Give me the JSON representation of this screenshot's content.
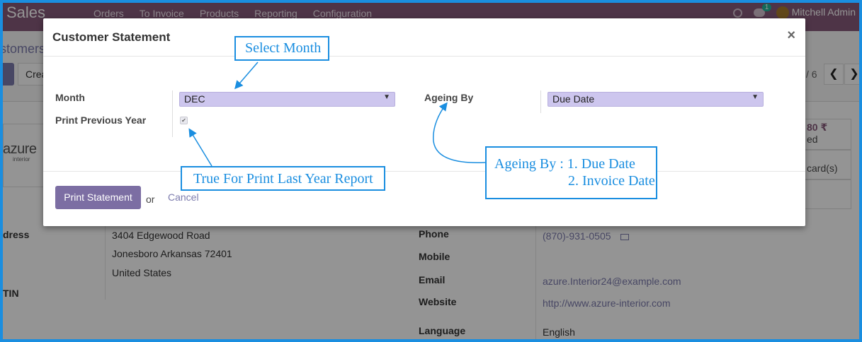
{
  "navbar": {
    "brand": "Sales",
    "menu": [
      "Orders",
      "To Invoice",
      "Products",
      "Reporting",
      "Configuration"
    ],
    "chat_count": "1",
    "user": "Mitchell Admin"
  },
  "background": {
    "breadcrumb": "stomers",
    "edit_label": "t",
    "create_label": "Crea",
    "pager": "/ 6",
    "pager_prev": "❮",
    "pager_next": "❯",
    "logo_text": "azure",
    "logo_sub": "interior",
    "stat_amount": "80 ₹",
    "stat_amount_sub": "ed",
    "stat_cards": "card(s)",
    "address_label": "dress",
    "address_lines": [
      "3404 Edgewood Road",
      "Jonesboro  Arkansas  72401",
      "United States"
    ],
    "tin_label": "TIN",
    "phone_label": "Phone",
    "phone": "(870)-931-0505",
    "mobile_label": "Mobile",
    "email_label": "Email",
    "email": "azure.Interior24@example.com",
    "website_label": "Website",
    "website": "http://www.azure-interior.com",
    "language_label": "Language",
    "language": "English"
  },
  "modal": {
    "title": "Customer Statement",
    "close": "×",
    "month_label": "Month",
    "month_value": "DEC",
    "print_prev_label": "Print Previous Year",
    "print_prev_checked": true,
    "ageing_label": "Ageing By",
    "ageing_value": "Due Date",
    "print_button": "Print Statement",
    "or_text": "or",
    "cancel": "Cancel"
  },
  "annotations": {
    "select_month": "Select Month",
    "print_last_year": "True For Print Last Year Report",
    "ageing_line1": "Ageing By : 1. Due Date",
    "ageing_line2": "2. Invoice Date"
  },
  "colors": {
    "navbar": "#875a7b",
    "primary_button": "#7c6ea3",
    "select_bg": "#cdc6ee",
    "annotation": "#1a8ee0"
  }
}
